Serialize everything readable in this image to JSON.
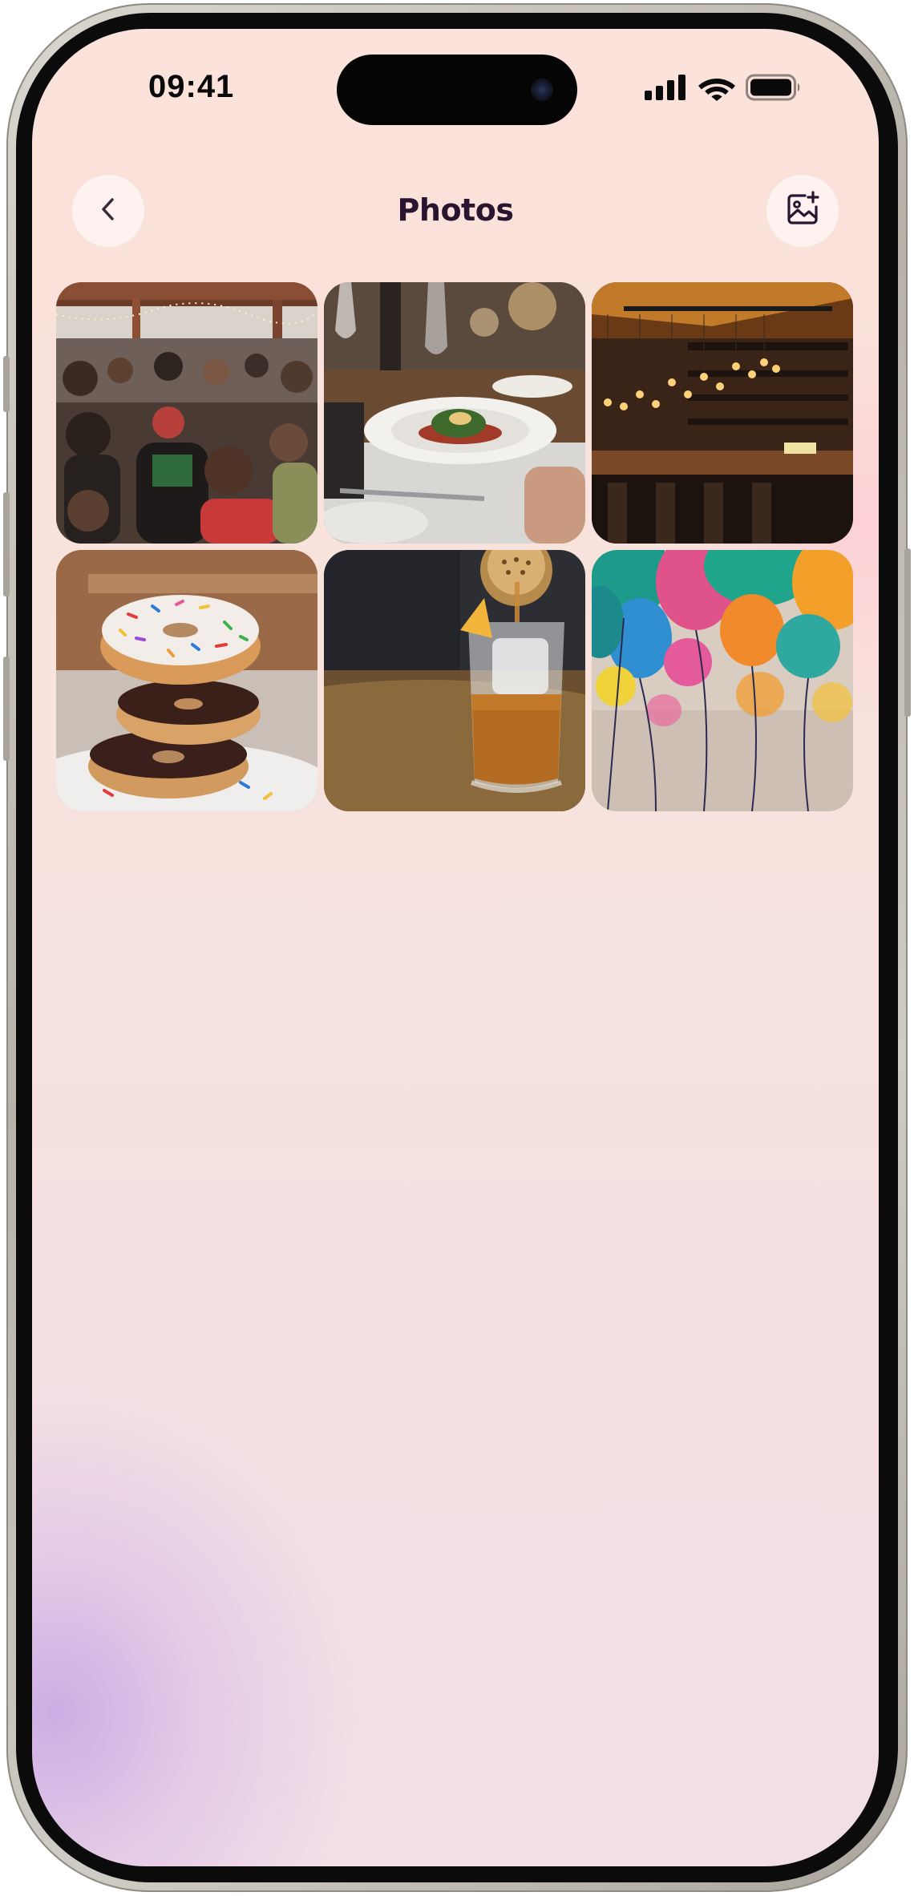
{
  "status_bar": {
    "time": "09:41"
  },
  "header": {
    "title": "Photos",
    "back_icon": "chevron-left-icon",
    "add_photo_icon": "add-photo-icon"
  },
  "photos": [
    {
      "subject": "crowd-at-outdoor-party"
    },
    {
      "subject": "plated-dinner-at-restaurant-table"
    },
    {
      "subject": "bar-with-hanging-lights"
    },
    {
      "subject": "stacked-sprinkle-donuts"
    },
    {
      "subject": "pouring-cocktail-over-ice"
    },
    {
      "subject": "colorful-balloons"
    }
  ],
  "colors": {
    "title": "#2a1530",
    "background_top": "#fbe2da",
    "background_accent": "#cbaae4"
  }
}
